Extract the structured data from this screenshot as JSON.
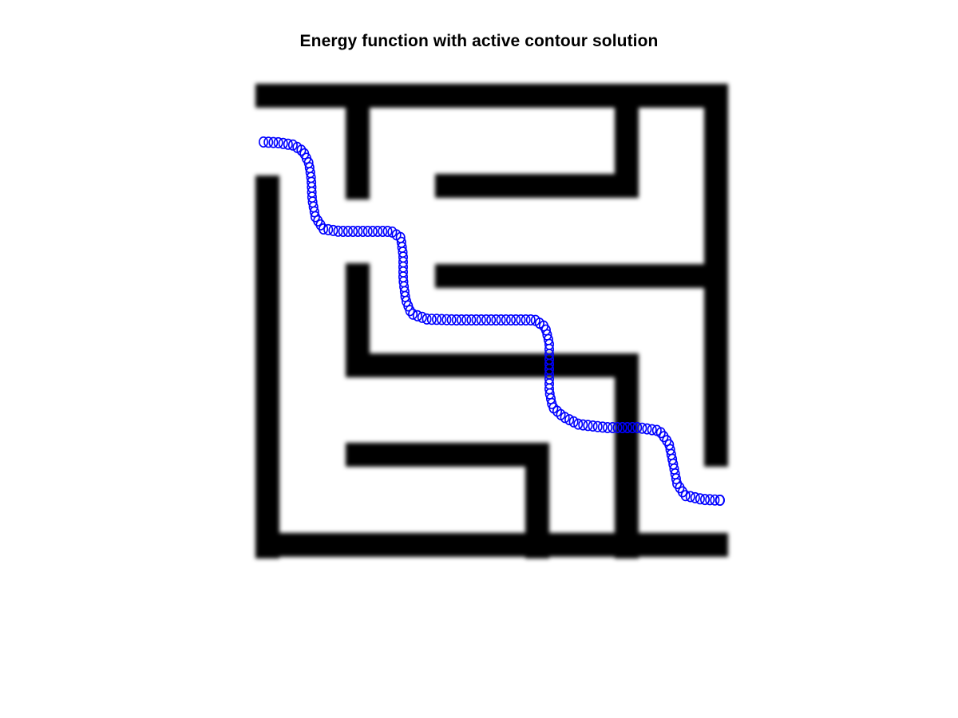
{
  "figure": {
    "title": "Energy function with active contour solution"
  },
  "colors": {
    "background": "#ffffff",
    "maze_walls": "#000000",
    "contour_markers": "#0000ff"
  },
  "legend": {
    "wall_fill": "black",
    "marker_shape": "hollow circle"
  }
}
